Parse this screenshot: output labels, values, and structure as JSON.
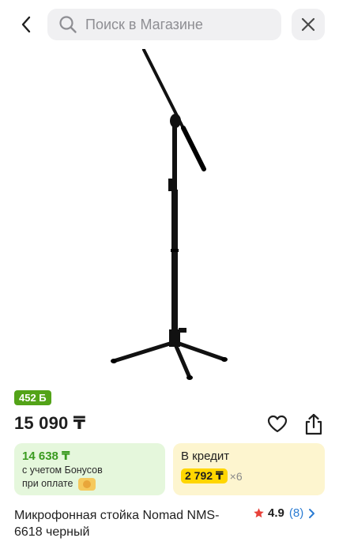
{
  "header": {
    "back_icon": "chevron-left-icon",
    "search_placeholder": "Поиск в Магазине",
    "search_icon": "search-icon",
    "close_icon": "close-icon"
  },
  "product": {
    "image_alt": "microphone-stand",
    "bonus_badge": "452 Б",
    "price": "15 090 ₸",
    "title": "Микрофонная стойка Nomad NMS-6618 черный",
    "rating": "4.9",
    "reviews": "(8)"
  },
  "cards": {
    "bonus_price": "14 638 ₸",
    "bonus_line1": "с учетом Бонусов",
    "bonus_line2": "при оплате",
    "credit_label": "В кредит",
    "credit_amount": "2 792 ₸",
    "credit_times": "×6"
  },
  "colors": {
    "accent_green": "#53a318",
    "credit_yellow": "#ffd600",
    "link_blue": "#2b7cd3",
    "star_red": "#e8413a"
  }
}
